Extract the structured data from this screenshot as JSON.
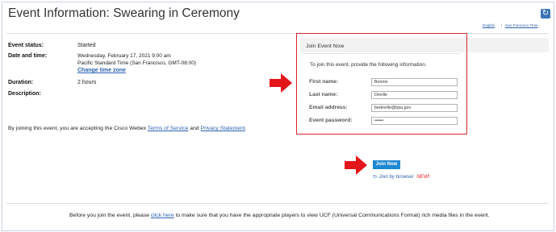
{
  "page": {
    "title": "Event Information: Swearing in Ceremony",
    "lang_english": "English",
    "lang_timezone": "San Francisco Time"
  },
  "info": {
    "status_label": "Event status:",
    "status_value": "Started",
    "datetime_label": "Date and time:",
    "date_value": "Wednesday, February 17, 2021 9:00 am",
    "tz_value": "Pacific Standard Time (San Francisco, GMT-08:00)",
    "change_tz": "Change time zone",
    "duration_label": "Duration:",
    "duration_value": "2 hours",
    "description_label": "Description:"
  },
  "terms": {
    "prefix": "By joining this event, you are accepting the Cisco Webex ",
    "tos": "Terms of Service",
    "and": " and ",
    "privacy": "Privacy Statement",
    "suffix": "."
  },
  "join_panel": {
    "title": "Join Event Now",
    "description": "To join this event, provide the following information.",
    "fields": [
      {
        "label": "First name:",
        "value": "Bonnie"
      },
      {
        "label": "Last name:",
        "value": "Deville"
      },
      {
        "label": "Email address:",
        "value": "bedeville@bpa.gov"
      },
      {
        "label": "Event password:",
        "value": "••••••"
      }
    ]
  },
  "join": {
    "button": "Join Now",
    "browser_link": "Join by browser",
    "new_tag": "NEW!"
  },
  "bottom": {
    "prefix": "Before you join the event, please ",
    "link": "click here",
    "suffix": " to make sure that you have the appropriate players to view UCF (Universal Communications Format) rich media files in the event."
  },
  "colors": {
    "accent_blue": "#2b62b0",
    "button_blue": "#1e88d2",
    "highlight_red": "#d9262c"
  }
}
